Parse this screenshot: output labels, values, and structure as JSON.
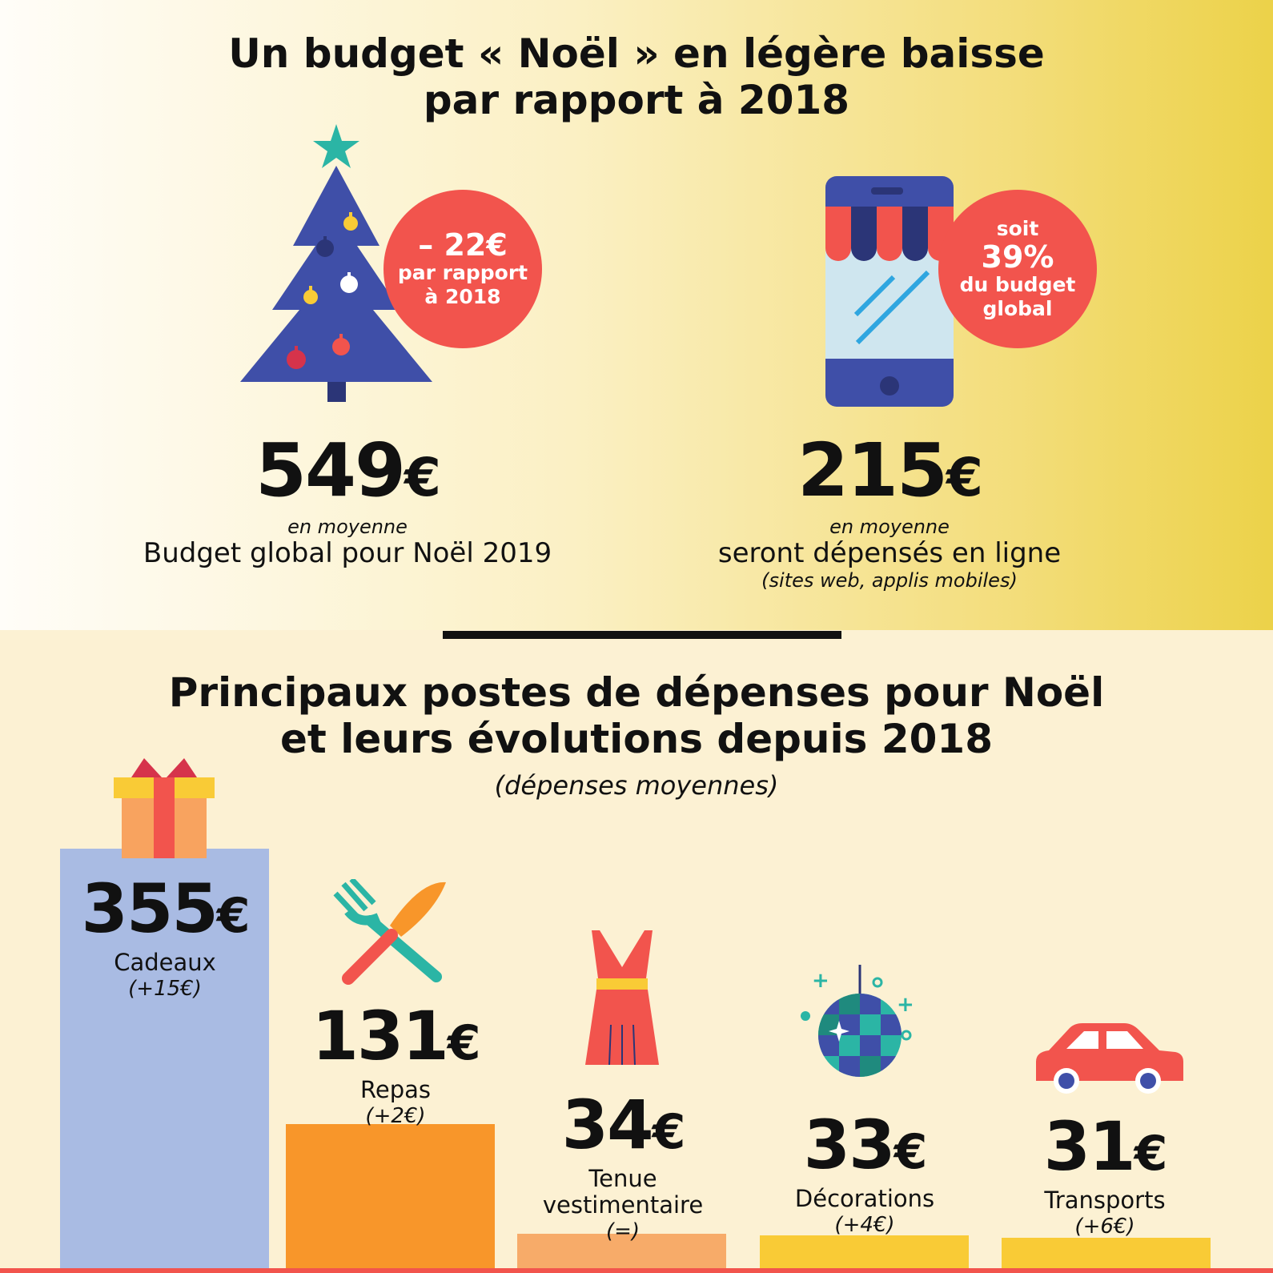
{
  "colors": {
    "badge": "#f2544d",
    "navy": "#3f4fa8",
    "bar_cadeaux": "#a9bbe3",
    "bar_repas": "#f8962a",
    "bar_tenue": "#f7ab69",
    "bar_deco": "#f9cb36",
    "bar_transports": "#f9cb36"
  },
  "header": {
    "title_line1": "Un budget « Noël » en légère baisse",
    "title_line2": "par rapport à 2018"
  },
  "stats": {
    "global": {
      "value": "549",
      "unit": "€",
      "moy": "en moyenne",
      "desc": "Budget global pour Noël 2019",
      "icon": "christmas-tree-icon",
      "badge": {
        "big": "– 22€",
        "line1": "par rapport",
        "line2": "à 2018"
      }
    },
    "online": {
      "value": "215",
      "unit": "€",
      "moy": "en moyenne",
      "desc": "seront dépensés en ligne",
      "note": "(sites web, applis mobiles)",
      "icon": "smartphone-shop-icon",
      "badge": {
        "top": "soit",
        "big": "39%",
        "line1": "du budget",
        "line2": "global"
      }
    }
  },
  "section2": {
    "title_line1": "Principaux postes de dépenses pour Noël",
    "title_line2": "et leurs évolutions depuis 2018",
    "subtitle": "(dépenses moyennes)"
  },
  "chart_data": {
    "type": "bar",
    "categories": [
      "Cadeaux",
      "Repas",
      "Tenue vestimentaire",
      "Décorations",
      "Transports"
    ],
    "values": [
      355,
      131,
      34,
      33,
      31
    ],
    "unit": "€",
    "changes": [
      "(+15€)",
      "(+2€)",
      "(=)",
      "(+4€)",
      "(+6€)"
    ],
    "icons": [
      "gift-icon",
      "cutlery-icon",
      "dress-icon",
      "disco-ball-icon",
      "car-icon"
    ],
    "title": "Principaux postes de dépenses pour Noël et leurs évolutions depuis 2018",
    "subtitle": "(dépenses moyennes)",
    "grid": false,
    "legend": "none"
  },
  "bars": [
    {
      "value": "355",
      "unit": "€",
      "cat1": "Cadeaux",
      "cat2": "",
      "change": "(+15€)"
    },
    {
      "value": "131",
      "unit": "€",
      "cat1": "Repas",
      "cat2": "",
      "change": "(+2€)"
    },
    {
      "value": "34",
      "unit": "€",
      "cat1": "Tenue",
      "cat2": "vestimentaire",
      "change": "(=)"
    },
    {
      "value": "33",
      "unit": "€",
      "cat1": "Décorations",
      "cat2": "",
      "change": "(+4€)"
    },
    {
      "value": "31",
      "unit": "€",
      "cat1": "Transports",
      "cat2": "",
      "change": "(+6€)"
    }
  ]
}
